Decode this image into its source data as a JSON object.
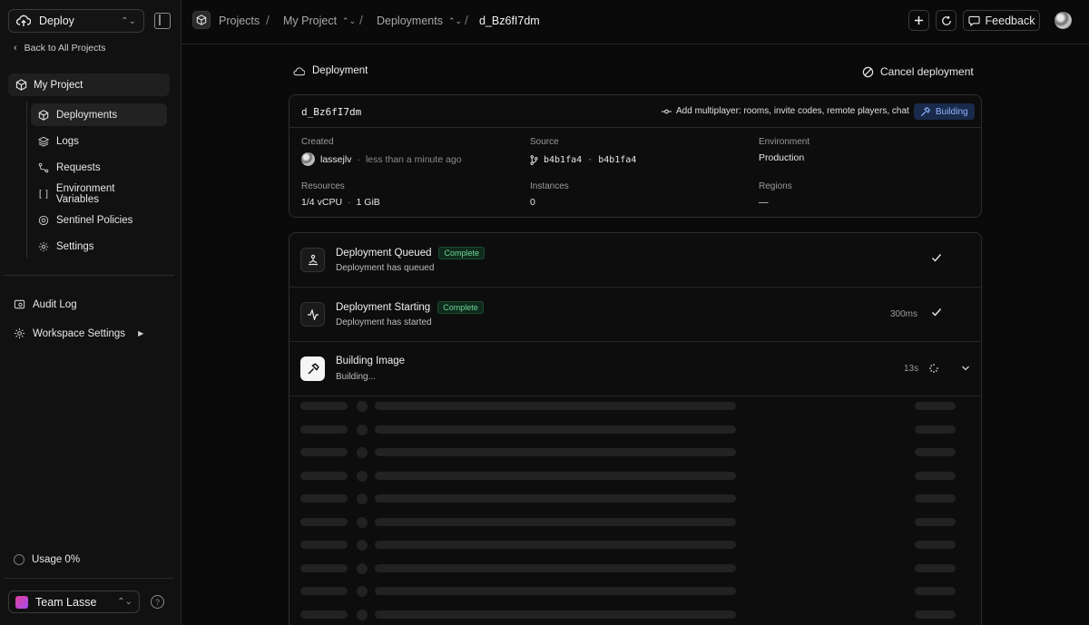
{
  "sidebar": {
    "app_name": "Deploy",
    "back_label": "Back to All Projects",
    "project_name": "My Project",
    "nav": [
      {
        "label": "Deployments",
        "icon": "cube-icon",
        "active": true
      },
      {
        "label": "Logs",
        "icon": "layers-icon"
      },
      {
        "label": "Requests",
        "icon": "route-icon"
      },
      {
        "label": "Environment Variables",
        "icon": "braces-icon"
      },
      {
        "label": "Sentinel Policies",
        "icon": "shield-icon"
      },
      {
        "label": "Settings",
        "icon": "gear-icon"
      }
    ],
    "audit_log": "Audit Log",
    "workspace_settings": "Workspace Settings",
    "usage": "Usage 0%",
    "team": "Team Lasse"
  },
  "topbar": {
    "crumbs": [
      "Projects",
      "My Project",
      "Deployments",
      "d_Bz6fI7dm"
    ],
    "feedback": "Feedback"
  },
  "main": {
    "section_title": "Deployment",
    "cancel_label": "Cancel deployment",
    "deployment_id": "d_Bz6fI7dm",
    "multiplayer_text": "Add multiplayer: rooms, invite codes, remote players, chat",
    "status": "Building",
    "created_label": "Created",
    "created_user": "lassejlv",
    "created_time": "less than a minute ago",
    "source_label": "Source",
    "source_branch": "b4b1fa4",
    "source_commit": "b4b1fa4",
    "environment_label": "Environment",
    "environment_value": "Production",
    "resources_label": "Resources",
    "resources_cpu": "1/4",
    "resources_cpu_unit": "vCPU",
    "resources_mem": "1 GiB",
    "instances_label": "Instances",
    "instances_value": "0",
    "regions_label": "Regions",
    "regions_value": "—",
    "steps": [
      {
        "title": "Deployment Queued",
        "badge": "Complete",
        "sub": "Deployment has queued",
        "time": ""
      },
      {
        "title": "Deployment Starting",
        "badge": "Complete",
        "sub": "Deployment has started",
        "time": "300ms"
      },
      {
        "title": "Building Image",
        "badge": "",
        "sub": "Building...",
        "time": "13s"
      }
    ]
  },
  "colors": {
    "background": "#0a0a0a",
    "sidebar": "#111111",
    "building_badge": "#8fb4ff",
    "complete_badge": "#6fd49a"
  }
}
